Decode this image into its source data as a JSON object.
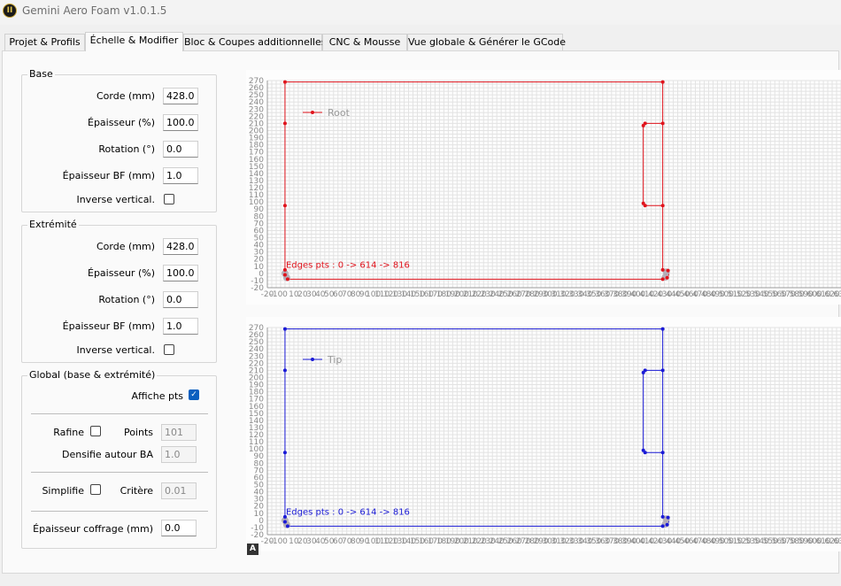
{
  "app": {
    "title": "Gemini Aero Foam v1.0.1.5",
    "icon": "roman-two-logo-icon",
    "icon_glyph": "II"
  },
  "tabs": [
    {
      "label": "Projet & Profils",
      "active": false
    },
    {
      "label": "Échelle & Modifier",
      "active": true
    },
    {
      "label": "Bloc & Coupes additionnelles",
      "active": false
    },
    {
      "label": "CNC & Mousse",
      "active": false
    },
    {
      "label": "Vue globale & Générer le GCode",
      "active": false
    }
  ],
  "base": {
    "title": "Base",
    "corde_label": "Corde (mm)",
    "corde_value": "428.0",
    "epaisseur_label": "Épaisseur (%)",
    "epaisseur_value": "100.0",
    "rotation_label": "Rotation (°)",
    "rotation_value": "0.0",
    "epaisseur_bf_label": "Épaisseur BF (mm)",
    "epaisseur_bf_value": "1.0",
    "inverse_label": "Inverse vertical.",
    "inverse_checked": false
  },
  "extremite": {
    "title": "Extrémité",
    "corde_label": "Corde (mm)",
    "corde_value": "428.0",
    "epaisseur_label": "Épaisseur (%)",
    "epaisseur_value": "100.0",
    "rotation_label": "Rotation (°)",
    "rotation_value": "0.0",
    "epaisseur_bf_label": "Épaisseur BF (mm)",
    "epaisseur_bf_value": "1.0",
    "inverse_label": "Inverse vertical.",
    "inverse_checked": false
  },
  "global": {
    "title": "Global (base & extrémité)",
    "affiche_pts_label": "Affiche pts",
    "affiche_pts_checked": true,
    "rafine_label": "Rafine",
    "rafine_checked": false,
    "points_label": "Points",
    "points_value": "101",
    "densifie_label": "Densifie autour BA",
    "densifie_value": "1.0",
    "simplifie_label": "Simplifie",
    "simplifie_checked": false,
    "critere_label": "Critère",
    "critere_value": "0.01",
    "coffrage_label": "Épaisseur coffrage (mm)",
    "coffrage_value": "0.0"
  },
  "colors": {
    "root": "#e0131c",
    "tip": "#1a1ad6",
    "grid": "#e3e3e3",
    "tick_text": "#8a8a8a",
    "endpoint": "#b0a8b4"
  },
  "plots": [
    {
      "name": "root",
      "legend": "Root",
      "annotation": "Edges pts : 0 -> 614 -> 816",
      "y_ticks": [
        "270",
        "260",
        "250",
        "240",
        "230",
        "220",
        "210",
        "200",
        "190",
        "180",
        "170",
        "160",
        "150",
        "140",
        "130",
        "120",
        "110",
        "100",
        "90",
        "80",
        "70",
        "60",
        "50",
        "40",
        "30",
        "20",
        "10",
        "0",
        "-10",
        "-20"
      ],
      "x_ticks": [
        "-20",
        "-10",
        "0",
        "10",
        "20",
        "30",
        "40",
        "50",
        "60",
        "70",
        "80",
        "90",
        "100",
        "110",
        "120",
        "130",
        "140",
        "150",
        "160",
        "170",
        "180",
        "190",
        "200",
        "210",
        "220",
        "230",
        "240",
        "250",
        "260",
        "270",
        "280",
        "290",
        "300",
        "310",
        "320",
        "330",
        "340",
        "350",
        "360",
        "370",
        "380",
        "390",
        "400",
        "410",
        "420",
        "430",
        "440",
        "450",
        "460",
        "470",
        "480",
        "490",
        "500",
        "510",
        "520",
        "530",
        "540",
        "550",
        "560",
        "570",
        "580",
        "590",
        "600",
        "610",
        "620",
        "630"
      ]
    },
    {
      "name": "tip",
      "legend": "Tip",
      "annotation": "Edges pts : 0 -> 614 -> 816",
      "y_ticks": [
        "270",
        "260",
        "250",
        "240",
        "230",
        "220",
        "210",
        "200",
        "190",
        "180",
        "170",
        "160",
        "150",
        "140",
        "130",
        "120",
        "110",
        "100",
        "90",
        "80",
        "70",
        "60",
        "50",
        "40",
        "30",
        "20",
        "10",
        "0",
        "-10",
        "-20"
      ],
      "x_ticks": [
        "-20",
        "-10",
        "0",
        "10",
        "20",
        "30",
        "40",
        "50",
        "60",
        "70",
        "80",
        "90",
        "100",
        "110",
        "120",
        "130",
        "140",
        "150",
        "160",
        "170",
        "180",
        "190",
        "200",
        "210",
        "220",
        "230",
        "240",
        "250",
        "260",
        "270",
        "280",
        "290",
        "300",
        "310",
        "320",
        "330",
        "340",
        "350",
        "360",
        "370",
        "380",
        "390",
        "400",
        "410",
        "420",
        "430",
        "440",
        "450",
        "460",
        "470",
        "480",
        "490",
        "500",
        "510",
        "520",
        "530",
        "540",
        "550",
        "560",
        "570",
        "580",
        "590",
        "600",
        "610",
        "620",
        "630"
      ]
    }
  ],
  "profile_points": {
    "outline": [
      [
        0,
        268
      ],
      [
        0,
        210
      ],
      [
        0,
        95
      ],
      [
        0,
        5
      ],
      [
        0,
        -2
      ],
      [
        0,
        -6
      ],
      [
        3,
        -8
      ],
      [
        428,
        -8
      ],
      [
        433,
        -6
      ],
      [
        435,
        -2
      ],
      [
        434,
        4
      ],
      [
        428,
        5
      ],
      [
        428,
        95
      ],
      [
        428,
        210
      ],
      [
        428,
        268
      ],
      [
        0,
        268
      ]
    ],
    "notch": [
      [
        428,
        210
      ],
      [
        408,
        210
      ],
      [
        406,
        207
      ],
      [
        406,
        98
      ],
      [
        408,
        95
      ],
      [
        428,
        95
      ]
    ],
    "points": [
      [
        0,
        268
      ],
      [
        428,
        268
      ],
      [
        0,
        210
      ],
      [
        428,
        210
      ],
      [
        408,
        210
      ],
      [
        406,
        207
      ],
      [
        0,
        95
      ],
      [
        406,
        98
      ],
      [
        408,
        95
      ],
      [
        428,
        95
      ],
      [
        0,
        5
      ],
      [
        0,
        -2
      ],
      [
        3,
        -8
      ],
      [
        428,
        -8
      ],
      [
        433,
        -6
      ],
      [
        434,
        4
      ],
      [
        428,
        5
      ]
    ],
    "endpoints": [
      [
        0,
        0
      ],
      [
        2,
        -6
      ],
      [
        431,
        -5
      ],
      [
        432,
        2
      ]
    ]
  },
  "autoscale_label": "A"
}
